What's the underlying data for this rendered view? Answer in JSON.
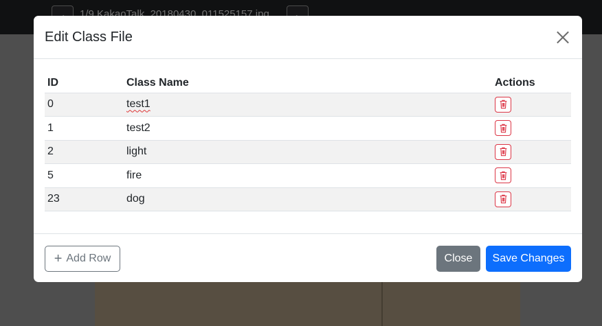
{
  "background": {
    "file_title": "1/9   KakaoTalk_20180430_011525157.jpg"
  },
  "modal": {
    "title": "Edit Class File",
    "table": {
      "headers": [
        "ID",
        "Class Name",
        "Actions"
      ],
      "rows": [
        {
          "id": "0",
          "name": "test1"
        },
        {
          "id": "1",
          "name": "test2"
        },
        {
          "id": "2",
          "name": "light"
        },
        {
          "id": "5",
          "name": "fire"
        },
        {
          "id": "23",
          "name": "dog"
        }
      ]
    },
    "footer": {
      "add_row_label": "Add Row",
      "close_label": "Close",
      "save_label": "Save Changes"
    }
  },
  "colors": {
    "primary": "#0d6efd",
    "secondary": "#6c757d",
    "danger": "#dc3545"
  },
  "icons": {
    "delete": "trash-icon",
    "close": "close-icon",
    "add": "plus-icon"
  }
}
